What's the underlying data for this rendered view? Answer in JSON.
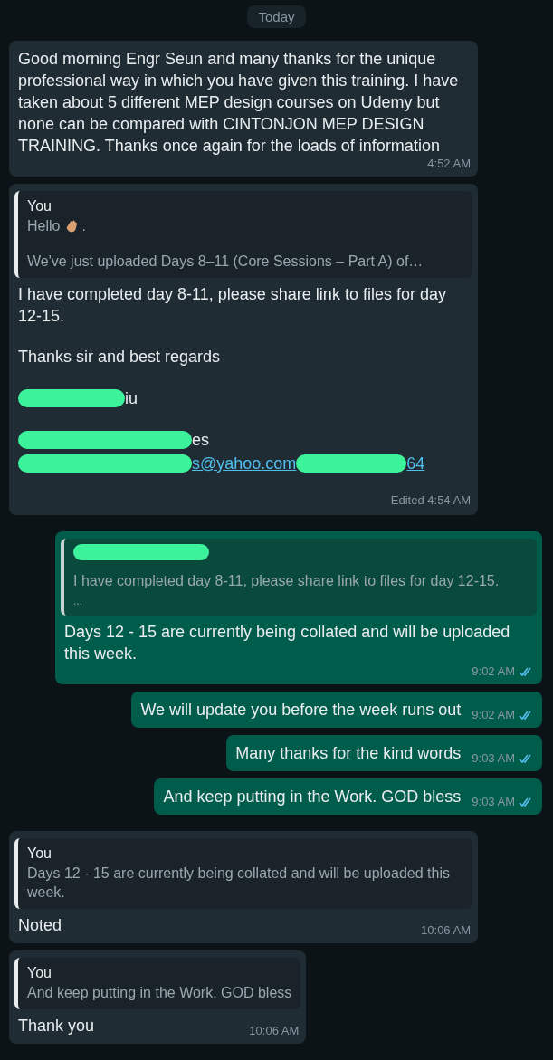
{
  "date_chip": "Today",
  "messages": [
    {
      "kind": "incoming",
      "text": "Good morning Engr Seun and many thanks for the unique professional way in which you have given this training. I have taken about 5 different MEP design courses on Udemy but none can be compared with CINTONJON MEP DESIGN TRAINING. Thanks once again for the loads of information",
      "time": "4:52 AM"
    },
    {
      "kind": "incoming",
      "quote": {
        "sender": "You",
        "lines": [
          {
            "text": "Hello",
            "emoji": true,
            "tail": "."
          },
          {
            "text": "We've just uploaded Days 8–11 (Core Sessions – Part A) of…"
          }
        ]
      },
      "paragraphs": [
        [
          [
            {
              "kind": "text",
              "text": "I have completed day 8-11, please share link to files for day 12-15."
            }
          ]
        ],
        [
          [
            {
              "kind": "text",
              "text": "Thanks sir and best regards"
            }
          ]
        ],
        [
          [
            {
              "kind": "redacted"
            },
            {
              "kind": "text",
              "text": "iu"
            }
          ]
        ],
        [
          [
            {
              "kind": "redacted"
            },
            {
              "kind": "text",
              "text": "es"
            }
          ],
          [
            {
              "kind": "redacted"
            },
            {
              "kind": "link",
              "text": "s@yahoo.com"
            },
            {
              "kind": "redacted"
            },
            {
              "kind": "link",
              "text": "64"
            }
          ]
        ]
      ],
      "time": "Edited 4:54 AM"
    },
    {
      "kind": "outgoing",
      "quote": {
        "sender_redacted": true,
        "lines": [
          {
            "text": "I have completed day 8-11, please share link to files for day 12-15."
          }
        ],
        "more": "..."
      },
      "text": "Days 12 - 15 are currently being collated and will be uploaded this week.",
      "time": "9:02 AM",
      "read": true
    },
    {
      "kind": "outgoing",
      "text": "We will update you before the week runs out",
      "time": "9:02 AM",
      "read": true
    },
    {
      "kind": "outgoing",
      "text": "Many thanks for the kind words",
      "time": "9:03 AM",
      "read": true
    },
    {
      "kind": "outgoing",
      "text": "And keep putting in the Work. GOD bless",
      "time": "9:03 AM",
      "read": true
    },
    {
      "kind": "incoming",
      "quote": {
        "sender": "You",
        "lines": [
          {
            "text": "Days 12 - 15 are currently being collated and will be uploaded this week."
          }
        ]
      },
      "text": "Noted",
      "time": "10:06 AM"
    },
    {
      "kind": "incoming",
      "quote": {
        "sender": "You",
        "lines": [
          {
            "text": "And keep putting in the Work. GOD bless"
          }
        ]
      },
      "text": "Thank you",
      "time": "10:06 AM"
    }
  ]
}
